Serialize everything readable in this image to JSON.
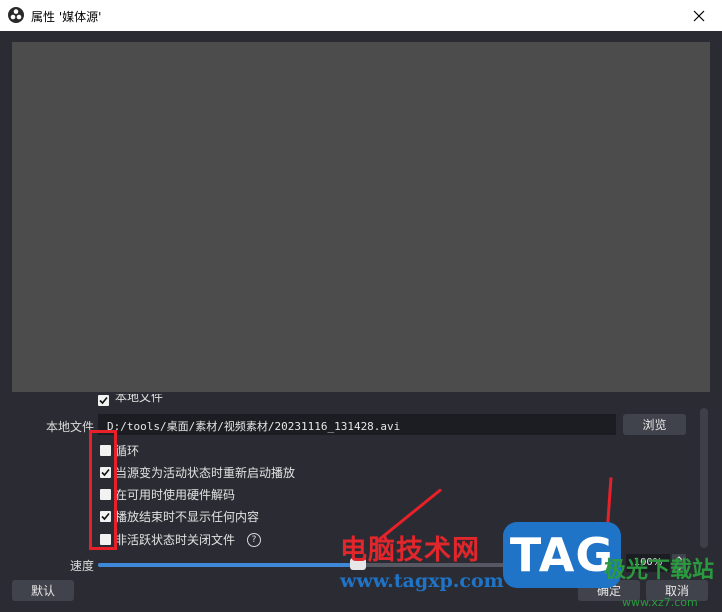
{
  "window": {
    "title": "属性 '媒体源'",
    "app_icon": "obs-icon",
    "close_icon": "close-icon"
  },
  "properties": {
    "local_file_toggle": {
      "label": "本地文件",
      "checked": true
    },
    "local_file": {
      "label": "本地文件",
      "path": "D:/tools/桌面/素材/视频素材/20231116_131428.avi",
      "browse_label": "浏览"
    },
    "checkboxes": [
      {
        "label": "循环",
        "checked": false
      },
      {
        "label": "当源变为活动状态时重新启动播放",
        "checked": true
      },
      {
        "label": "在可用时使用硬件解码",
        "checked": false
      },
      {
        "label": "播放结束时不显示任何内容",
        "checked": true
      },
      {
        "label": "非活跃状态时关闭文件",
        "checked": false,
        "help_icon": "help-icon"
      }
    ],
    "speed": {
      "label": "速度",
      "value_text": "100%",
      "value_fraction": 0.5
    }
  },
  "footer": {
    "default_label": "默认",
    "ok_label": "确定",
    "cancel_label": "取消"
  },
  "watermark": {
    "title": "电脑技术网",
    "url": "www.tagxp.com",
    "badge": "TAG",
    "corner": "极光下载站",
    "corner_sub": "www.xz7.com"
  },
  "colors": {
    "annotation": "#e8202a",
    "accent": "#3d88d8",
    "watermark_blue": "#1f74c8",
    "watermark_red": "#e1262c"
  }
}
